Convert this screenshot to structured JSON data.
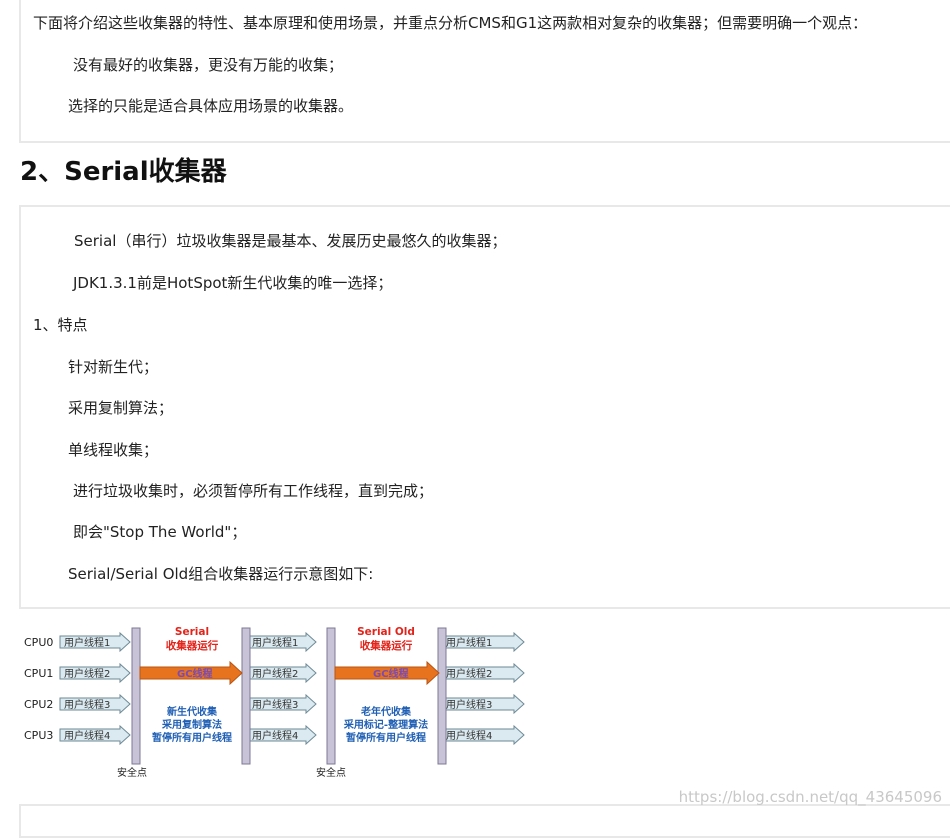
{
  "intro": {
    "lines": [
      "下面将介绍这些收集器的特性、基本原理和使用场景，并重点分析CMS和G1这两款相对复杂的收集器；但需要明确一个观点：",
      "没有最好的收集器，更没有万能的收集；",
      "选择的只能是适合具体应用场景的收集器。"
    ]
  },
  "section": {
    "title": "2、Serial收集器",
    "lines": [
      "Serial（串行）垃圾收集器是最基本、发展历史最悠久的收集器；",
      "JDK1.3.1前是HotSpot新生代收集的唯一选择；",
      "1、特点",
      "针对新生代；",
      "采用复制算法；",
      "单线程收集；",
      "进行垃圾收集时，必须暂停所有工作线程，直到完成；",
      "即会\"Stop The World\"；",
      "Serial/Serial Old组合收集器运行示意图如下:"
    ]
  },
  "diagram": {
    "cpus": [
      "CPU0",
      "CPU1",
      "CPU2",
      "CPU3"
    ],
    "threads": [
      "用户线程1",
      "用户线程2",
      "用户线程3",
      "用户线程4"
    ],
    "gc_label": "GC线程",
    "safepoint": "安全点",
    "phase1": {
      "title1": "Serial",
      "title2": "收集器运行",
      "desc": [
        "新生代收集",
        "采用复制算法",
        "暂停所有用户线程"
      ]
    },
    "phase2": {
      "title1": "Serial Old",
      "title2": "收集器运行",
      "desc": [
        "老年代收集",
        "采用标记-整理算法",
        "暂停所有用户线程"
      ]
    },
    "colors": {
      "arrow_fill": "#dbeaf0",
      "arrow_stroke": "#6e8a96",
      "gc_fill": "#e8731f",
      "bar_fill": "#c9c3d8",
      "title_red": "#e2231a",
      "desc_blue": "#1f5fb4"
    }
  },
  "watermark": "https://blog.csdn.net/qq_43645096"
}
